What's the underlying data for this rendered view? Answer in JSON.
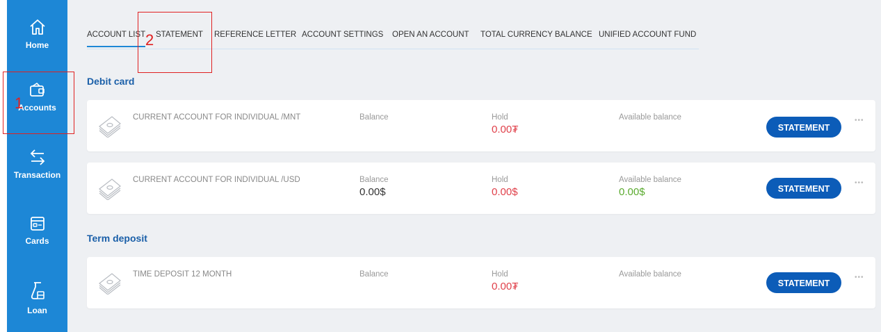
{
  "sidebar": {
    "items": [
      {
        "label": "Home",
        "icon": "home-icon"
      },
      {
        "label": "Accounts",
        "icon": "wallet-icon"
      },
      {
        "label": "Transaction",
        "icon": "transfer-arrows-icon"
      },
      {
        "label": "Cards",
        "icon": "card-icon"
      },
      {
        "label": "Loan",
        "icon": "loan-icon"
      }
    ]
  },
  "tabs": [
    "ACCOUNT LIST",
    "STATEMENT",
    "REFERENCE LETTER",
    "ACCOUNT SETTINGS",
    "OPEN AN ACCOUNT",
    "TOTAL CURRENCY BALANCE",
    "UNIFIED ACCOUNT FUND"
  ],
  "active_tab": "ACCOUNT LIST",
  "sections": [
    {
      "title": "Debit card",
      "accounts": [
        {
          "name": "CURRENT ACCOUNT FOR INDIVIDUAL /MNT",
          "balance_label": "Balance",
          "balance": "",
          "hold_label": "Hold",
          "hold": "0.00₮",
          "available_label": "Available balance",
          "available": "",
          "button": "STATEMENT"
        },
        {
          "name": "CURRENT ACCOUNT FOR INDIVIDUAL /USD",
          "balance_label": "Balance",
          "balance": "0.00$",
          "hold_label": "Hold",
          "hold": "0.00$",
          "available_label": "Available balance",
          "available": "0.00$",
          "button": "STATEMENT"
        }
      ]
    },
    {
      "title": "Term deposit",
      "accounts": [
        {
          "name": "TIME DEPOSIT 12 MONTH",
          "balance_label": "Balance",
          "balance": "",
          "hold_label": "Hold",
          "hold": "0.00₮",
          "available_label": "Available balance",
          "available": "",
          "button": "STATEMENT"
        }
      ]
    }
  ],
  "annotations": [
    "1",
    "2"
  ],
  "colors": {
    "sidebar": "#1d87d6",
    "button": "#0c5cb8",
    "hold": "#e0404a",
    "available": "#5aaa2e",
    "annotation": "#e02020"
  }
}
